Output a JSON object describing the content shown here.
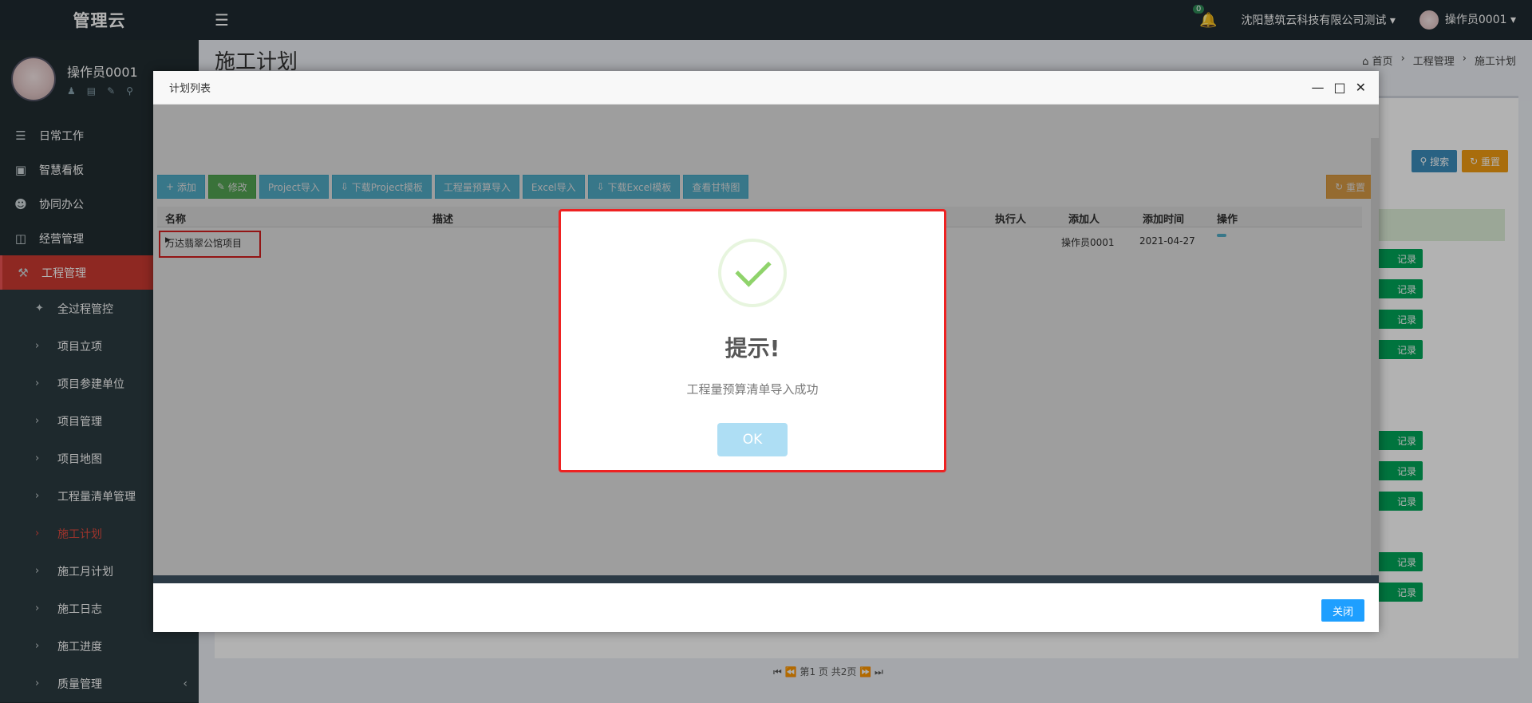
{
  "sidebar": {
    "logo": "管理云",
    "user_name": "操作员0001",
    "menu": [
      {
        "label": "日常工作",
        "icon": "indent-icon"
      },
      {
        "label": "智慧看板",
        "icon": "dashboard-icon"
      },
      {
        "label": "协同办公",
        "icon": "users-icon"
      },
      {
        "label": "经营管理",
        "icon": "monitor-icon"
      },
      {
        "label": "工程管理",
        "icon": "hammer-icon"
      }
    ],
    "submenu": [
      {
        "label": "全过程管控"
      },
      {
        "label": "项目立项"
      },
      {
        "label": "项目参建单位"
      },
      {
        "label": "项目管理"
      },
      {
        "label": "项目地图"
      },
      {
        "label": "工程量清单管理"
      },
      {
        "label": "施工计划"
      },
      {
        "label": "施工月计划"
      },
      {
        "label": "施工日志"
      },
      {
        "label": "施工进度"
      },
      {
        "label": "质量管理"
      }
    ]
  },
  "navbar": {
    "notification_count": "0",
    "company": "沈阳慧筑云科技有限公司测试",
    "user": "操作员0001"
  },
  "content": {
    "page_title": "施工计划",
    "breadcrumb": [
      "首页",
      "工程管理",
      "施工计划"
    ],
    "search_label": "搜索",
    "reset_label": "重置",
    "record_label": "记录",
    "pager": {
      "page_prefix": "第",
      "page_value": "1",
      "page_suffix": "页",
      "total": "共2页"
    }
  },
  "modal": {
    "title": "计划列表",
    "toolbar": {
      "add": "添加",
      "edit": "修改",
      "project_import": "Project导入",
      "download_project_tpl": "下载Project模板",
      "budget_import": "工程量预算导入",
      "excel_import": "Excel导入",
      "download_excel_tpl": "下载Excel模板",
      "view_gantt": "查看甘特图",
      "reset": "重置"
    },
    "columns": {
      "name": "名称",
      "desc": "描述",
      "executor": "执行人",
      "adder": "添加人",
      "added_time": "添加时间",
      "action": "操作"
    },
    "rows": [
      {
        "name": "万达翡翠公馆项目",
        "adder": "操作员0001",
        "added_time": "2021-04-27",
        "action": "详情"
      }
    ],
    "close_button": "关闭"
  },
  "alert": {
    "title": "提示!",
    "message": "工程量预算清单导入成功",
    "ok": "OK",
    "colors": {
      "tick": "#8fd36b",
      "ok_button": "#aedef4",
      "highlight_border": "#e22"
    }
  }
}
